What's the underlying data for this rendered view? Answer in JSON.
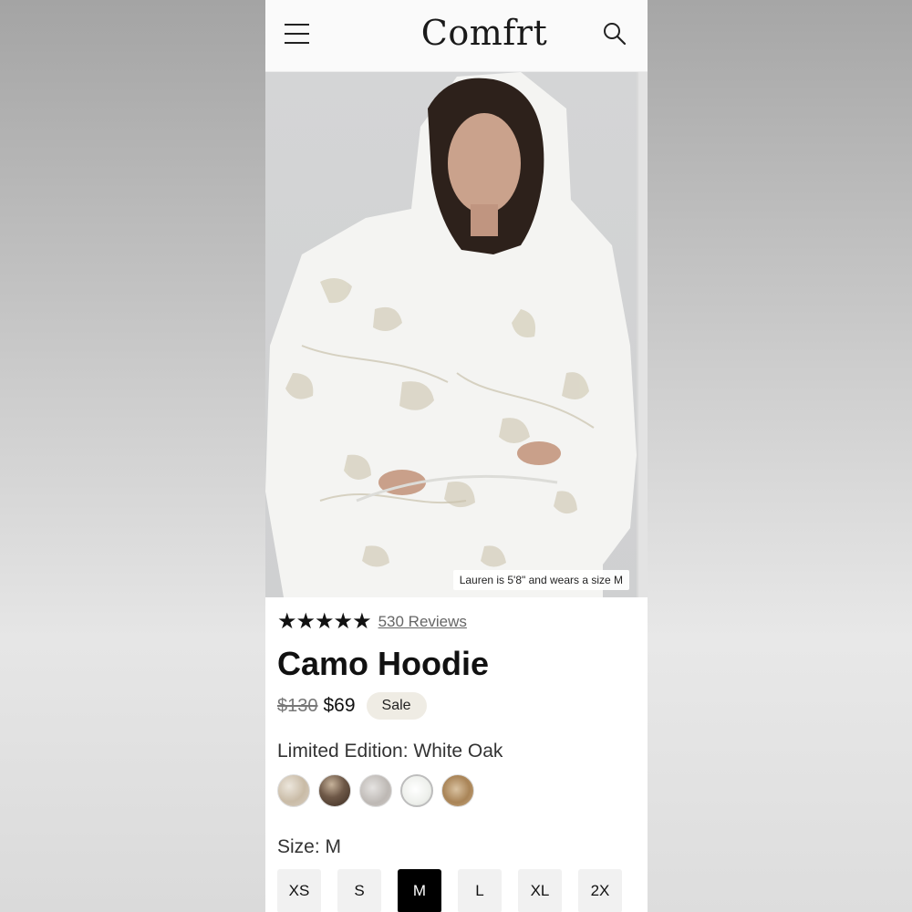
{
  "header": {
    "logo": "Comfrt",
    "menu_icon": "hamburger-menu-icon",
    "search_icon": "search-icon"
  },
  "gallery": {
    "caption": "Lauren is 5'8\" and wears a size M"
  },
  "product": {
    "rating_stars": "★★★★★",
    "rating_value": 5,
    "reviews_label": "530 Reviews",
    "title": "Camo Hoodie",
    "old_price": "$130",
    "new_price": "$69",
    "sale_badge": "Sale",
    "color_label": "Limited Edition: White Oak",
    "swatches": [
      "swatch-1",
      "swatch-2",
      "swatch-3",
      "swatch-4-selected",
      "swatch-5"
    ],
    "size_label": "Size: M",
    "sizes": [
      "XS",
      "S",
      "M",
      "L",
      "XL",
      "2X"
    ],
    "selected_size": "M"
  },
  "colors": {
    "accent": "#000000",
    "sale_badge_bg": "#efece4",
    "text": "#111111"
  }
}
